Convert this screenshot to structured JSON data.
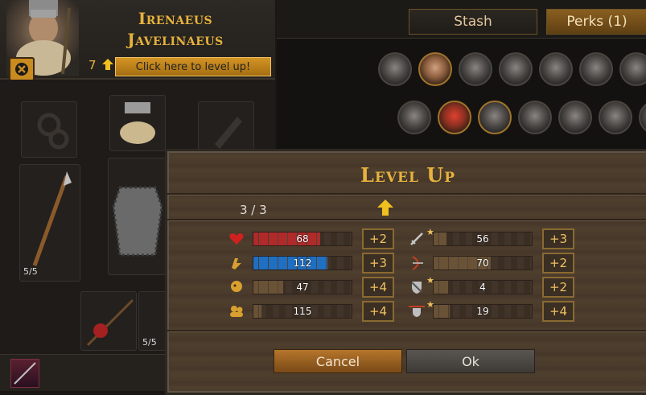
{
  "character": {
    "name_line1": "Irenaeus",
    "name_line2": "Javelinaeus",
    "levels_available": "7",
    "level_up_prompt": "Click here to level up!"
  },
  "tabs": {
    "stash": "Stash",
    "perks": "Perks (1)"
  },
  "paperdoll": {
    "slot_count_left": "5/5",
    "slot_count_bottom": "5/5"
  },
  "dialog": {
    "title": "Level Up",
    "points": "3 / 3",
    "cancel_label": "Cancel",
    "ok_label": "Ok",
    "stats_left": [
      {
        "icon": "heart-icon",
        "value": "68",
        "fill": 0.68,
        "color": "#b02a2a",
        "plus": "+2"
      },
      {
        "icon": "resolve-icon",
        "value": "112",
        "fill": 0.75,
        "color": "#1f6fc2",
        "plus": "+3"
      },
      {
        "icon": "lion-icon",
        "value": "47",
        "fill": 0.3,
        "color": "#6a5236",
        "plus": "+4"
      },
      {
        "icon": "initiative-icon",
        "value": "115",
        "fill": 0.08,
        "color": "#6a5236",
        "plus": "+4"
      }
    ],
    "stats_right": [
      {
        "icon": "sword-icon",
        "value": "56",
        "fill": 0.13,
        "color": "#6a5236",
        "plus": "+3",
        "star": true
      },
      {
        "icon": "bow-icon",
        "value": "70",
        "fill": 0.58,
        "color": "#6a5236",
        "plus": "+2",
        "star": false
      },
      {
        "icon": "shield-icon",
        "value": "4",
        "fill": 0.15,
        "color": "#6a5236",
        "plus": "+2",
        "star": true
      },
      {
        "icon": "ranged-defense-icon",
        "value": "19",
        "fill": 0.16,
        "color": "#6a5236",
        "plus": "+4",
        "star": true
      }
    ]
  }
}
